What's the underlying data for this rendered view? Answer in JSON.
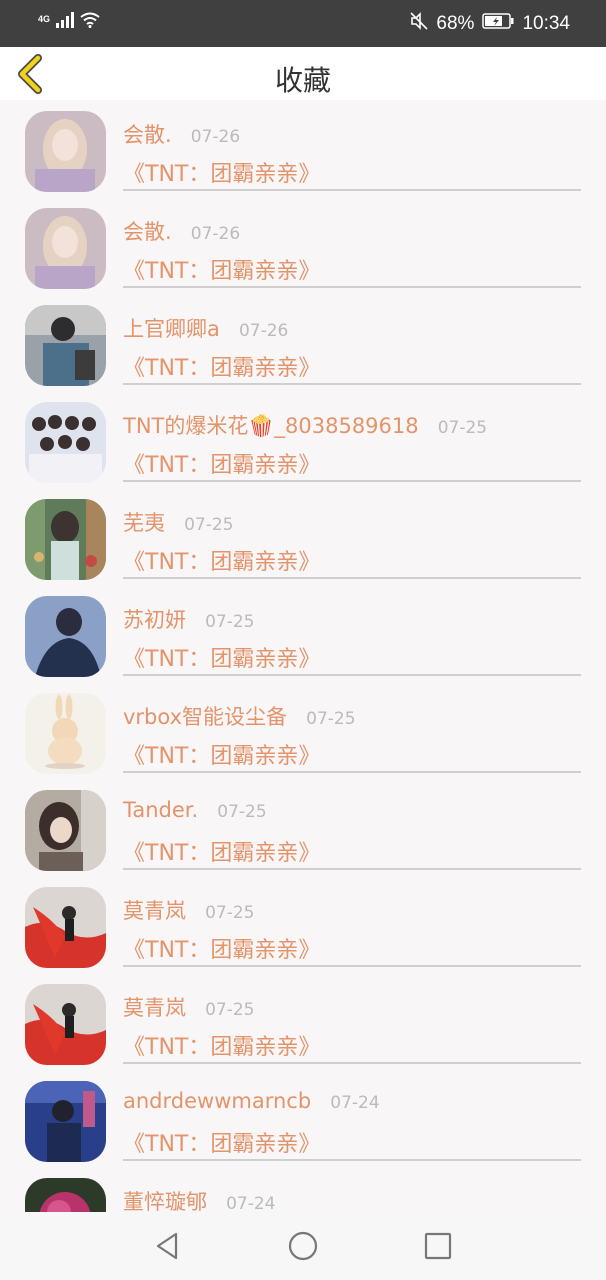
{
  "status_bar": {
    "network_type": "4G",
    "battery_percent": "68%",
    "time": "10:34",
    "icons": [
      "signal-icon",
      "wifi-icon",
      "mute-icon",
      "battery-icon"
    ]
  },
  "header": {
    "title": "收藏",
    "back_icon": "chevron-left-icon"
  },
  "colors": {
    "accent": "#e3946a",
    "back_arrow": "#f2d21a",
    "date_gray": "#bbbbbb",
    "background": "#f8f6f7"
  },
  "list": {
    "items": [
      {
        "username": "会散.",
        "date": "07-26",
        "title": "《TNT：团霸亲亲》"
      },
      {
        "username": "会散.",
        "date": "07-26",
        "title": "《TNT：团霸亲亲》"
      },
      {
        "username": "上官卿卿a",
        "date": "07-26",
        "title": "《TNT：团霸亲亲》"
      },
      {
        "username": "TNT的爆米花🍿_8038589618",
        "date": "07-25",
        "title": "《TNT：团霸亲亲》"
      },
      {
        "username": "芜夷",
        "date": "07-25",
        "title": "《TNT：团霸亲亲》"
      },
      {
        "username": "苏初妍",
        "date": "07-25",
        "title": "《TNT：团霸亲亲》"
      },
      {
        "username": "vrbox智能设尘备",
        "date": "07-25",
        "title": "《TNT：团霸亲亲》"
      },
      {
        "username": "Tander.",
        "date": "07-25",
        "title": "《TNT：团霸亲亲》"
      },
      {
        "username": "莫青岚",
        "date": "07-25",
        "title": "《TNT：团霸亲亲》"
      },
      {
        "username": "莫青岚",
        "date": "07-25",
        "title": "《TNT：团霸亲亲》"
      },
      {
        "username": "andrdewwmarncb",
        "date": "07-24",
        "title": "《TNT：团霸亲亲》"
      },
      {
        "username": "董悴璇郇",
        "date": "07-24",
        "title": ""
      }
    ]
  },
  "nav_bar": {
    "buttons": [
      "back-triangle-icon",
      "home-circle-icon",
      "recents-square-icon"
    ]
  }
}
